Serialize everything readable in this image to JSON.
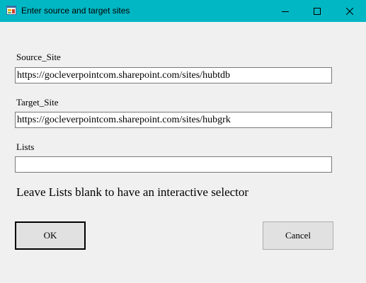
{
  "window": {
    "title": "Enter source and target sites",
    "icons": [
      "app-icon",
      "minimize-icon",
      "maximize-icon",
      "close-icon"
    ]
  },
  "form": {
    "source_label": "Source_Site",
    "source_value": "https://gocleverpointcom.sharepoint.com/sites/hubtdb",
    "target_label": "Target_Site",
    "target_value": "https://gocleverpointcom.sharepoint.com/sites/hubgrk",
    "lists_label": "Lists",
    "lists_value": "",
    "hint": "Leave Lists blank to have an interactive selector"
  },
  "buttons": {
    "ok_label": "OK",
    "cancel_label": "Cancel"
  },
  "colors": {
    "titlebar": "#00b7c3",
    "background": "#f0f0f0",
    "button_face": "#e1e1e1"
  }
}
